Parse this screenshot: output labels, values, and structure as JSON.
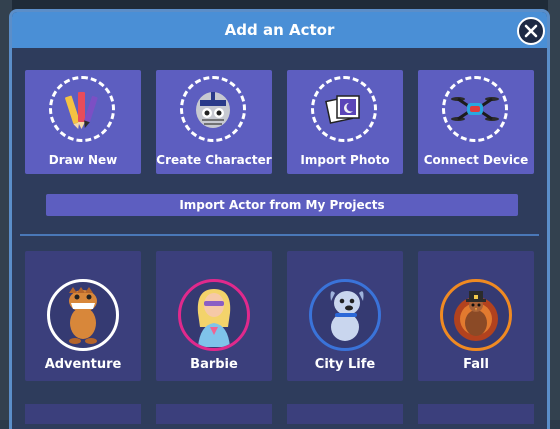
{
  "dialog": {
    "title": "Add an Actor"
  },
  "actions": [
    {
      "label": "Draw New",
      "icon": "pencil-brushes-icon"
    },
    {
      "label": "Create Character",
      "icon": "football-character-icon"
    },
    {
      "label": "Import Photo",
      "icon": "photos-icon"
    },
    {
      "label": "Connect Device",
      "icon": "drone-icon"
    }
  ],
  "import_projects": {
    "label": "Import Actor from My Projects"
  },
  "themes": [
    {
      "label": "Adventure",
      "ring_color": "#ffffff"
    },
    {
      "label": "Barbie",
      "ring_color": "#e0298c"
    },
    {
      "label": "City Life",
      "ring_color": "#3a73d9"
    },
    {
      "label": "Fall",
      "ring_color": "#f08a22"
    }
  ],
  "colors": {
    "header": "#4a8fd6",
    "tile": "#5d5ec0",
    "theme_tile": "#3b3f7c",
    "dialog_bg": "#2e3c5c"
  }
}
